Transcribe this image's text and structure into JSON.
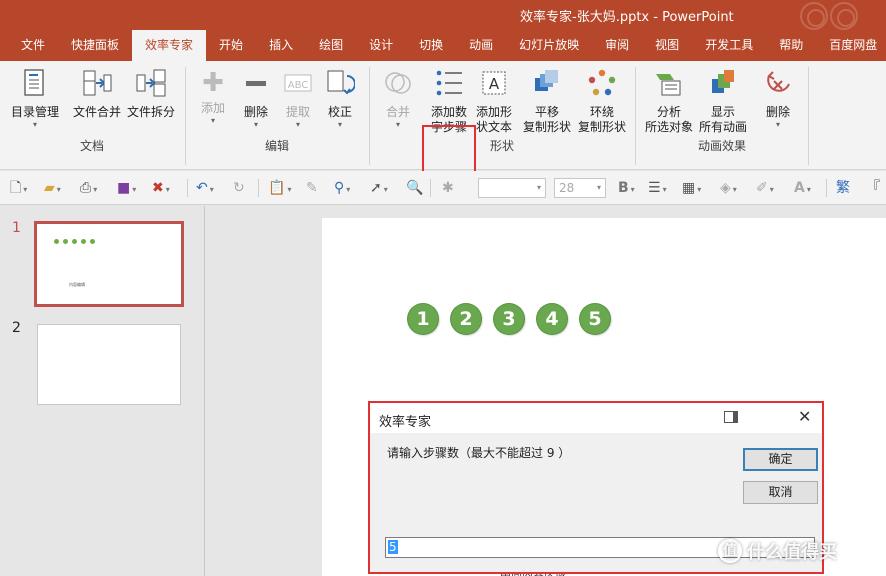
{
  "window": {
    "title": "效率专家-张大妈.pptx  -  PowerPoint"
  },
  "tabs": [
    "文件",
    "快捷面板",
    "效率专家",
    "开始",
    "插入",
    "绘图",
    "设计",
    "切换",
    "动画",
    "幻灯片放映",
    "审阅",
    "视图",
    "开发工具",
    "帮助",
    "百度网盘"
  ],
  "active_tab": "效率专家",
  "ribbon": {
    "groups": {
      "doc": "文档",
      "edit": "编辑",
      "shape": "形状",
      "anim": "动画效果"
    },
    "buttons": {
      "toc": "目录管理",
      "merge_file": "文件合并",
      "split_file": "文件拆分",
      "add": "添加",
      "delete": "删除",
      "extract": "提取",
      "proofread": "校正",
      "combine": "合并",
      "add_number_steps": "添加数\n字步骤",
      "add_shape_text": "添加形\n状文本",
      "pan_copy": "平移\n复制形状",
      "ring_copy": "环绕\n复制形状",
      "analyze_selected": "分析\n所选对象",
      "show_all_anim": "显示\n所有动画",
      "anim_delete": "删除"
    }
  },
  "quick_toolbar": {
    "font_size": "28"
  },
  "slides": [
    {
      "number": "1",
      "selected": true,
      "thumb_caption": "内容编辑"
    },
    {
      "number": "2",
      "selected": false
    }
  ],
  "canvas": {
    "step_numbers": [
      "1",
      "2",
      "3",
      "4",
      "5"
    ],
    "step_color": "#6aa84f",
    "partial_text": "中间内容区域"
  },
  "dialog": {
    "title": "效率专家",
    "prompt": "请输入步骤数（最大不能超过 9 ）",
    "ok_label": "确定",
    "cancel_label": "取消",
    "input_value": "5"
  },
  "watermark": {
    "logo": "值",
    "text": "什么值得买"
  },
  "colors": {
    "accent": "#b7472a",
    "highlight": "#e03030"
  }
}
